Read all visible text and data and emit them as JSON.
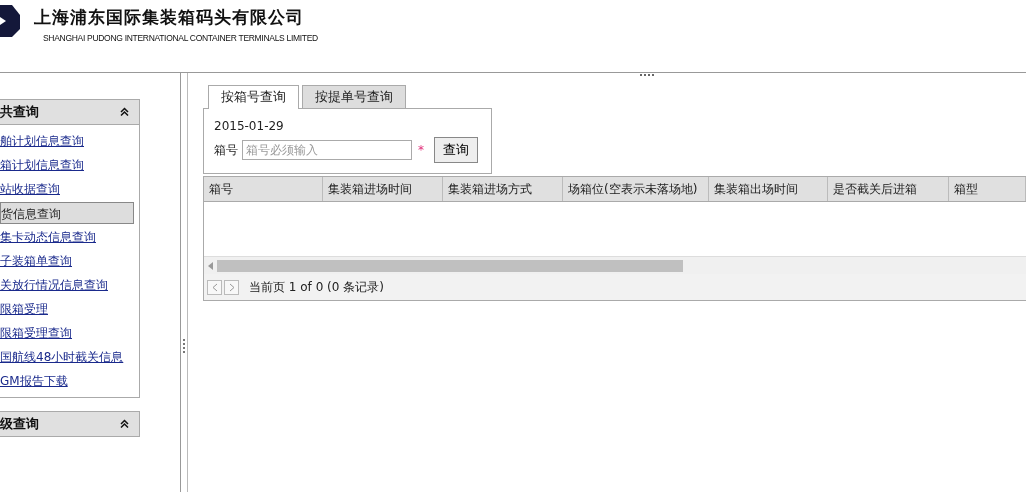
{
  "header": {
    "company_name": "上海浦东国际集装箱码头有限公司",
    "company_name_en": "SHANGHAI PUDONG INTERNATIONAL CONTAINER TERMINALS LIMITED"
  },
  "sidebar": {
    "sections": [
      {
        "title": "共查询",
        "items": [
          {
            "label": "舶计划信息查询",
            "selected": false
          },
          {
            "label": "箱计划信息查询",
            "selected": false
          },
          {
            "label": "站收据查询",
            "selected": false
          },
          {
            "label": "货信息查询",
            "selected": true
          },
          {
            "label": "集卡动态信息查询",
            "selected": false
          },
          {
            "label": "子装箱单查询",
            "selected": false
          },
          {
            "label": "关放行情况信息查询",
            "selected": false
          },
          {
            "label": "限箱受理",
            "selected": false
          },
          {
            "label": "限箱受理查询",
            "selected": false
          },
          {
            "label": "国航线48小时截关信息",
            "selected": false
          },
          {
            "label": "GM报告下载",
            "selected": false
          }
        ]
      },
      {
        "title": "级查询"
      }
    ]
  },
  "tabs": [
    {
      "label": "按箱号查询",
      "selected": true
    },
    {
      "label": "按提单号查询",
      "selected": false
    }
  ],
  "form": {
    "date": "2015-01-29",
    "field_label": "箱号",
    "placeholder": "箱号必须输入",
    "required_mark": "*",
    "button": "查询"
  },
  "table": {
    "columns": [
      "箱号",
      "集装箱进场时间",
      "集装箱进场方式",
      "场箱位(空表示未落场地)",
      "集装箱出场时间",
      "是否截关后进箱",
      "箱型"
    ]
  },
  "pager": {
    "text": "当前页 1 of 0 (0 条记录)"
  }
}
